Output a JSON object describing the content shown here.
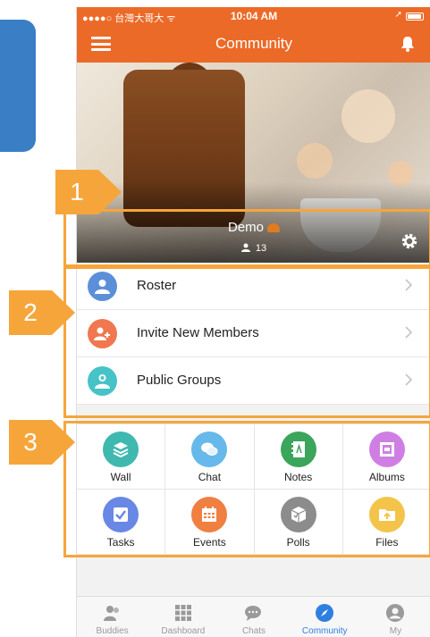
{
  "status_bar": {
    "carrier": "●●●●○ 台灣大哥大 ᯤ",
    "time": "10:04 AM",
    "location_arrow": "➚"
  },
  "nav": {
    "title": "Community",
    "menu_icon": "hamburger-icon",
    "bell_icon": "bell-icon"
  },
  "hero": {
    "group_name": "Demo",
    "member_count": "13",
    "settings_icon": "gear-icon"
  },
  "list": [
    {
      "label": "Roster",
      "color": "#5b8fd8",
      "icon": "user-icon"
    },
    {
      "label": "Invite New Members",
      "color": "#f0774f",
      "icon": "add-user-icon"
    },
    {
      "label": "Public Groups",
      "color": "#45c3c6",
      "icon": "group-icon"
    }
  ],
  "grid": [
    {
      "label": "Wall",
      "color": "#3fb8b0",
      "icon": "layers-icon"
    },
    {
      "label": "Chat",
      "color": "#66b9ea",
      "icon": "chat-icon"
    },
    {
      "label": "Notes",
      "color": "#3aa55b",
      "icon": "notebook-icon"
    },
    {
      "label": "Albums",
      "color": "#cf7fe3",
      "icon": "album-icon"
    },
    {
      "label": "Tasks",
      "color": "#6987e4",
      "icon": "checkbox-icon"
    },
    {
      "label": "Events",
      "color": "#f07f42",
      "icon": "calendar-icon"
    },
    {
      "label": "Polls",
      "color": "#8c8c8c",
      "icon": "poll-box-icon"
    },
    {
      "label": "Files",
      "color": "#f4c34a",
      "icon": "folder-icon"
    }
  ],
  "tabs": [
    {
      "label": "Buddies",
      "icon": "buddies-icon",
      "active": false
    },
    {
      "label": "Dashboard",
      "icon": "dashboard-grid-icon",
      "active": false
    },
    {
      "label": "Chats",
      "icon": "chats-icon",
      "active": false
    },
    {
      "label": "Community",
      "icon": "compass-icon",
      "active": true
    },
    {
      "label": "My",
      "icon": "profile-icon",
      "active": false
    }
  ],
  "annotations": [
    {
      "number": "1",
      "color": "#f6a53b"
    },
    {
      "number": "2",
      "color": "#f6a53b"
    },
    {
      "number": "3",
      "color": "#f6a53b"
    }
  ],
  "accent_color": "#ec6a27",
  "active_tab_color": "#2f7fe0"
}
